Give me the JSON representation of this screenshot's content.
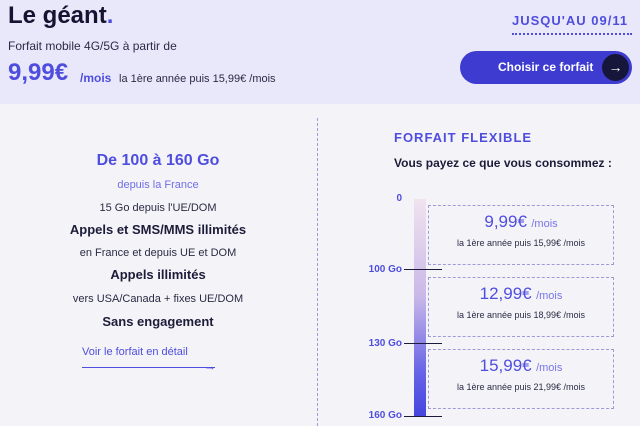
{
  "header": {
    "brand": "Le géant",
    "brand_dot": ".",
    "subtitle": "Forfait mobile 4G/5G à partir de",
    "price": "9,99€",
    "price_unit": "/mois",
    "price_note": "la 1ère année puis 15,99€ /mois",
    "promo": "JUSQU'AU 09/11",
    "cta_label": "Choisir ce forfait",
    "cta_arrow": "→"
  },
  "features": {
    "data_range": "De 100 à 160 Go",
    "data_origin": "depuis la France",
    "eu_data": "15 Go depuis l'UE/DOM",
    "calls_sms": "Appels et SMS/MMS illimités",
    "calls_sms_scope": "en France et depuis UE et DOM",
    "calls_intl": "Appels illimités",
    "calls_intl_scope": "vers USA/Canada + fixes UE/DOM",
    "commitment": "Sans engagement",
    "detail_link": "Voir le forfait en détail",
    "detail_arrow": "→"
  },
  "flexible": {
    "title": "FORFAIT FLEXIBLE",
    "subtitle": "Vous payez ce que vous consommez :",
    "scale_labels": [
      "0",
      "100 Go",
      "130 Go",
      "160 Go"
    ],
    "tiers": [
      {
        "price": "9,99€",
        "unit": "/mois",
        "note": "la 1ère année puis 15,99€ /mois"
      },
      {
        "price": "12,99€",
        "unit": "/mois",
        "note": "la 1ère année puis 18,99€ /mois"
      },
      {
        "price": "15,99€",
        "unit": "/mois",
        "note": "la 1ère année puis 21,99€ /mois"
      }
    ]
  },
  "colors": {
    "accent": "#4f4dde",
    "button": "#3d3bd0",
    "header_bg": "#e9e8fb",
    "dark": "#16163a"
  }
}
